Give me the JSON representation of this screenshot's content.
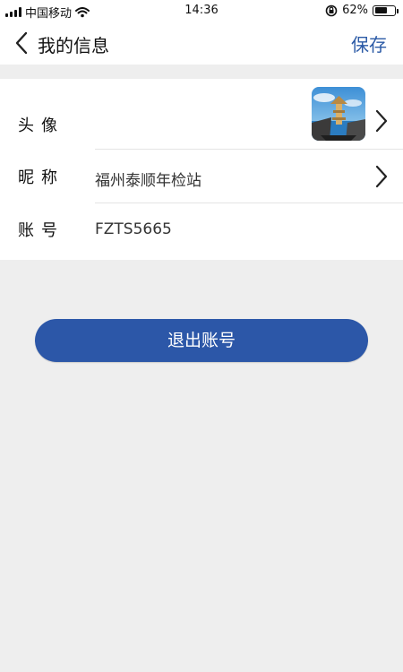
{
  "status_bar": {
    "carrier": "中国移动",
    "time": "14:36",
    "battery_text": "62%",
    "battery_level": 0.62
  },
  "nav": {
    "title": "我的信息",
    "save_label": "保存"
  },
  "profile": {
    "avatar_label": "头像",
    "nickname_label": "昵称",
    "nickname_value": "福州泰顺年检站",
    "account_label": "账号",
    "account_value": "FZTS5665"
  },
  "actions": {
    "logout_label": "退出账号"
  },
  "colors": {
    "accent": "#2c57a8",
    "save_text": "#2b5aa6",
    "page_bg": "#eeeeee"
  }
}
